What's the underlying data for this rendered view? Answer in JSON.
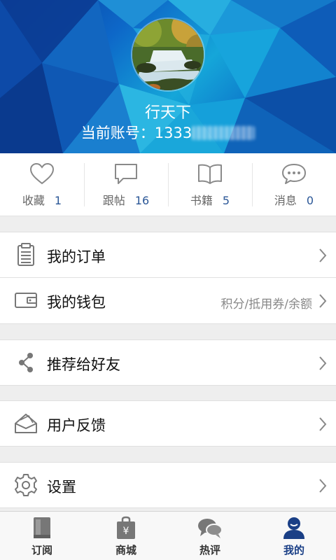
{
  "profile": {
    "name": "行天下",
    "account_label": "当前账号：1333"
  },
  "stats": [
    {
      "label": "收藏",
      "count": "1",
      "icon": "heart-icon"
    },
    {
      "label": "跟帖",
      "count": "16",
      "icon": "comment-icon"
    },
    {
      "label": "书籍",
      "count": "5",
      "icon": "book-icon"
    },
    {
      "label": "消息",
      "count": "0",
      "icon": "message-icon"
    }
  ],
  "menu": {
    "orders": {
      "label": "我的订单",
      "icon": "clipboard-icon"
    },
    "wallet": {
      "label": "我的钱包",
      "hint": "积分/抵用券/余额",
      "icon": "wallet-icon"
    },
    "share": {
      "label": "推荐给好友",
      "icon": "share-icon"
    },
    "feedback": {
      "label": "用户反馈",
      "icon": "envelope-icon"
    },
    "settings": {
      "label": "设置",
      "icon": "gear-icon"
    }
  },
  "tabs": [
    {
      "label": "订阅",
      "icon": "subscribe-book-icon",
      "active": false
    },
    {
      "label": "商城",
      "icon": "shopping-bag-icon",
      "active": false
    },
    {
      "label": "热评",
      "icon": "comments-icon",
      "active": false
    },
    {
      "label": "我的",
      "icon": "user-icon",
      "active": true
    }
  ],
  "colors": {
    "accent": "#1a3f86",
    "count": "#2b5797",
    "hint": "#888888",
    "icon_gray": "#777777"
  }
}
